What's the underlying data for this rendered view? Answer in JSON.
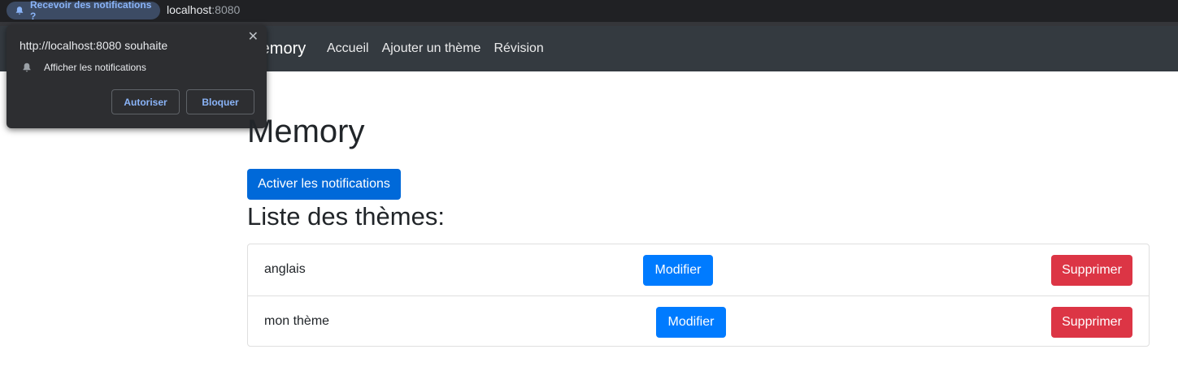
{
  "browser": {
    "notification_chip_label": "Recevoir des notifications ?",
    "url_host": "localhost",
    "url_port": ":8080"
  },
  "permission_popup": {
    "title": "http://localhost:8080 souhaite",
    "request": "Afficher les notifications",
    "allow_label": "Autoriser",
    "block_label": "Bloquer",
    "close_glyph": "✕"
  },
  "navbar": {
    "brand": "Memory",
    "links": [
      "Accueil",
      "Ajouter un thème",
      "Révision"
    ]
  },
  "main": {
    "title": "Memory",
    "notify_button": "Activer les notifications",
    "section_title": "Liste des thèmes:",
    "themes": [
      {
        "name": "anglais",
        "edit_label": "Modifier",
        "delete_label": "Supprimer"
      },
      {
        "name": "mon thème",
        "edit_label": "Modifier",
        "delete_label": "Supprimer"
      }
    ]
  },
  "colors": {
    "navbar_bg": "#343a40",
    "primary": "#007bff",
    "danger": "#dc3545",
    "popup_bg": "#2d2e31",
    "popup_accent": "#8ab4f8"
  }
}
